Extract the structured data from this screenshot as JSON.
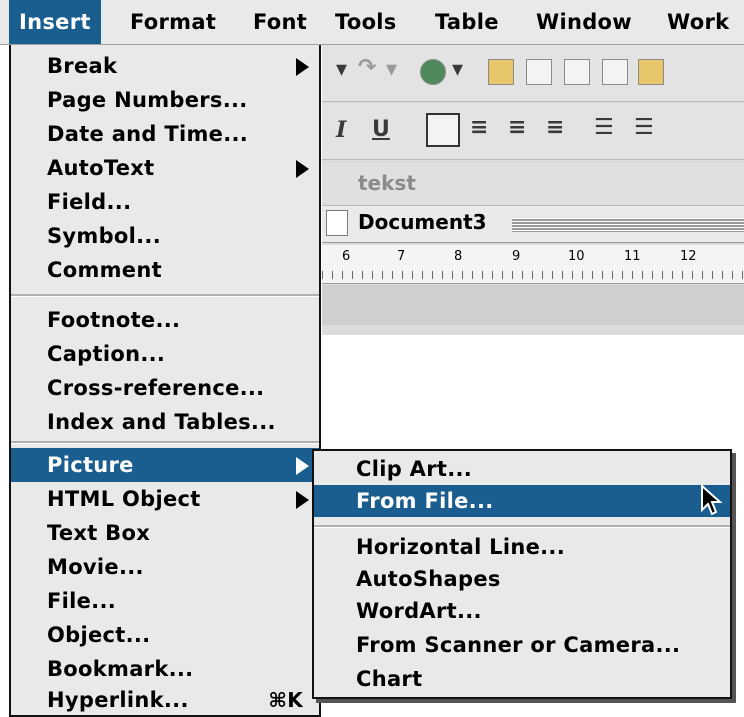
{
  "menubar": {
    "items": [
      {
        "label": "Insert",
        "active": true
      },
      {
        "label": "Format"
      },
      {
        "label": "Font"
      },
      {
        "label": "Tools"
      },
      {
        "label": "Table"
      },
      {
        "label": "Window"
      },
      {
        "label": "Work"
      }
    ]
  },
  "document": {
    "title": "Document3",
    "behind_title": "tekst",
    "ruler_numbers": [
      "6",
      "7",
      "8",
      "9",
      "10",
      "11",
      "12"
    ]
  },
  "toolbar": {
    "undo_glyph": "↶",
    "redo_glyph": "↷",
    "italic_label": "I",
    "underline_label": "U"
  },
  "insert_menu": {
    "group1": [
      {
        "label": "Break",
        "submenu": true
      },
      {
        "label": "Page Numbers..."
      },
      {
        "label": "Date and Time..."
      },
      {
        "label": "AutoText",
        "submenu": true
      },
      {
        "label": "Field..."
      },
      {
        "label": "Symbol..."
      },
      {
        "label": "Comment"
      }
    ],
    "group2": [
      {
        "label": "Footnote..."
      },
      {
        "label": "Caption..."
      },
      {
        "label": "Cross-reference..."
      },
      {
        "label": "Index and Tables..."
      }
    ],
    "group3": [
      {
        "label": "Picture",
        "submenu": true,
        "highlighted": true
      },
      {
        "label": "HTML Object",
        "submenu": true
      },
      {
        "label": "Text Box"
      },
      {
        "label": "Movie..."
      },
      {
        "label": "File..."
      },
      {
        "label": "Object..."
      },
      {
        "label": "Bookmark..."
      },
      {
        "label": "Hyperlink...",
        "shortcut": "⌘K"
      }
    ]
  },
  "picture_submenu": {
    "group1": [
      {
        "label": "Clip Art..."
      },
      {
        "label": "From File...",
        "highlighted": true
      }
    ],
    "group2": [
      {
        "label": "Horizontal Line..."
      },
      {
        "label": "AutoShapes"
      },
      {
        "label": "WordArt..."
      },
      {
        "label": "From Scanner or Camera..."
      },
      {
        "label": "Chart"
      }
    ]
  },
  "colors": {
    "highlight": "#1a5d8f",
    "menu_bg": "#e9e9e9"
  }
}
